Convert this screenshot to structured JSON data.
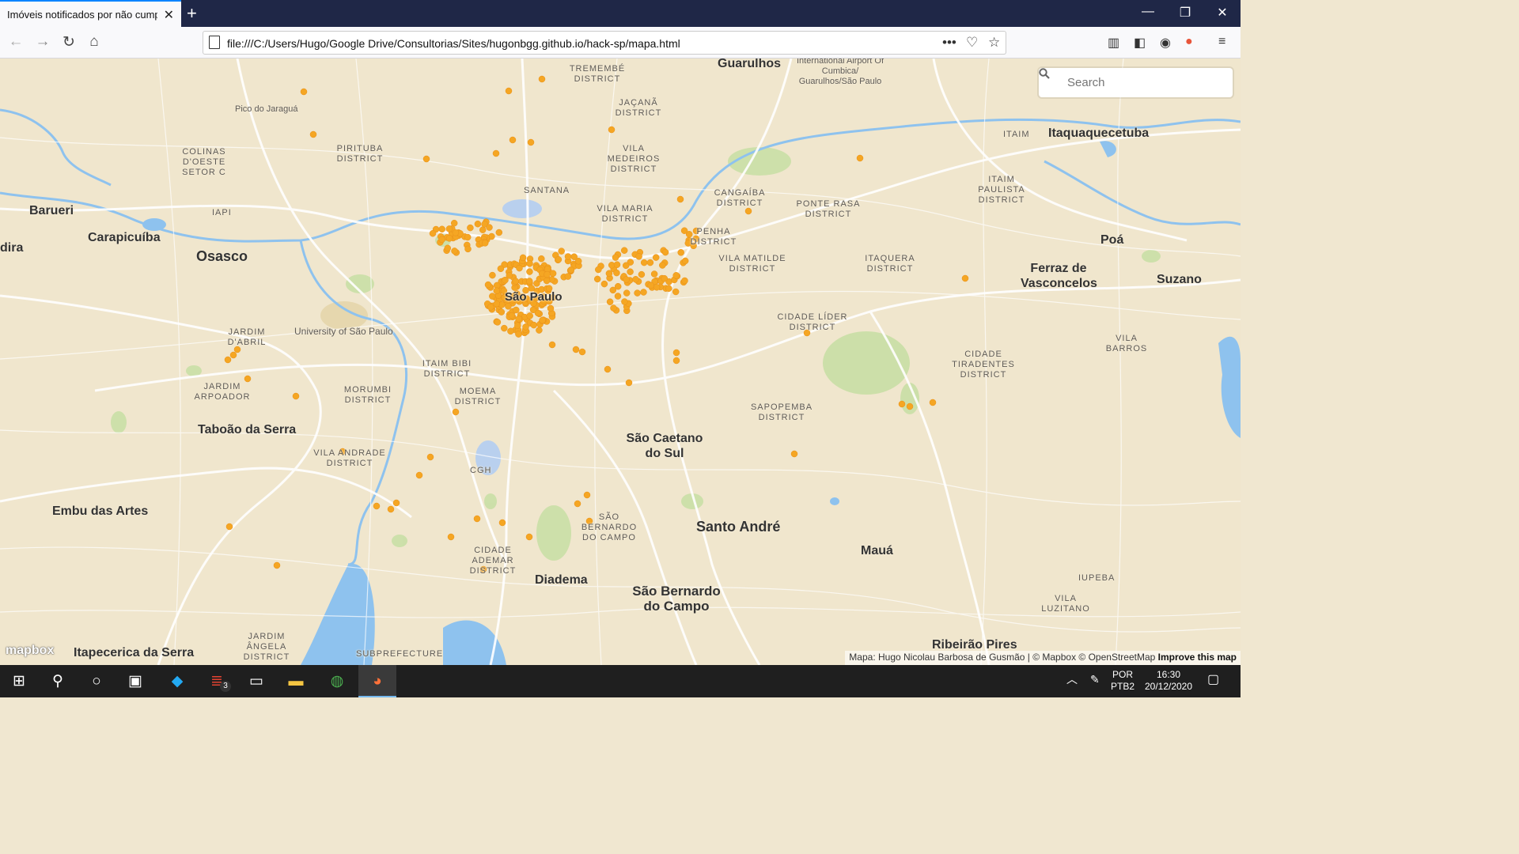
{
  "browser": {
    "tab_title": "Imóveis notificados por não cumprir",
    "url": "file:///C:/Users/Hugo/Google Drive/Consultorias/Sites/hugonbgg.github.io/hack-sp/mapa.html"
  },
  "map": {
    "search_placeholder": "Search",
    "logo_text": "mapbox",
    "attribution": "Mapa: Hugo Nicolau Barbosa de Gusmão | © Mapbox © OpenStreetMap",
    "improve_link": "Improve this map",
    "marker_color": "#f5a623",
    "labels": {
      "guarulhos": "Guarulhos",
      "airport": "International Airport Of Cumbica/ Guarulhos/São Paulo",
      "tremembe": "Tremembé District",
      "jacana": "Jaçanã District",
      "pico": "Pico do Jaraguá",
      "pirituba": "Pirituba District",
      "colinas": "Colinas D'Oeste Setor C",
      "vila_medeiros": "Vila Medeiros District",
      "santana": "Santana",
      "vila_maria": "Vila Maria District",
      "cangaiba": "Cangaíba District",
      "ponte_rasa": "Ponte Rasa District",
      "itaim": "Itaim",
      "itaquaquecetuba": "Itaquaquecetuba",
      "itaim_paulista": "Itaim Paulista District",
      "barueri": "Barueri",
      "iapi": "IAPI",
      "carapicuiba": "Carapicuíba",
      "osasco": "Osasco",
      "dira": "dira",
      "penha": "Penha District",
      "vila_matilde": "Vila Matilde District",
      "itaquera": "Itaquera District",
      "ferraz": "Ferraz de Vasconcelos",
      "poa": "Poá",
      "suzano": "Suzano",
      "usp": "University of São Paulo",
      "jardim_bril": "Jardim D'Abril",
      "cidade_lider": "Cidade Líder District",
      "cidade_tiradentes": "Cidade Tiradentes District",
      "vila_barros": "Vila Barros",
      "itaim_bibi": "Itaim Bibi District",
      "jardim_arpoador": "Jardim Arpoador",
      "morumbi": "Morumbi District",
      "moema": "Moema District",
      "sapopemba": "Sapopemba District",
      "taboao": "Taboão da Serra",
      "sao_caetano": "São Caetano do Sul",
      "vila_andrade": "Vila Andrade District",
      "cgh": "CGH",
      "embu": "Embu das Artes",
      "sbc_district": "São Bernardo do Campo",
      "santo_andre": "Santo André",
      "maua": "Mauá",
      "cidade_ademar": "Cidade Ademar District",
      "diadema": "Diadema",
      "sbc": "São Bernardo do Campo",
      "iupeba": "Iupeba",
      "vila_luzitano": "Vila Luzitano",
      "jardim_angela": "Jardim Ângela District",
      "itapecerica": "Itapecerica da Serra",
      "subprefecture": "Subprefecture",
      "ribeirao": "Ribeirão Pires",
      "center": "São Paulo"
    }
  },
  "taskbar": {
    "todoist_badge": "3",
    "lang_top": "POR",
    "lang_bottom": "PTB2",
    "time": "16:30",
    "date": "20/12/2020"
  }
}
